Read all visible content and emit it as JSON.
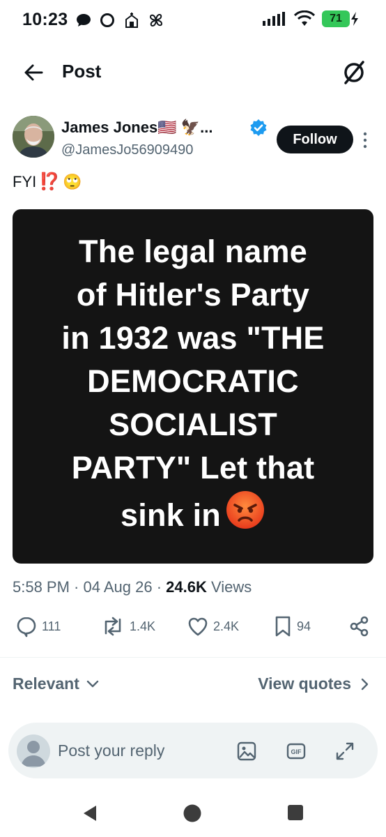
{
  "status_bar": {
    "time": "10:23",
    "battery": "71",
    "notification_icons": [
      "chat-bubble-icon",
      "circle-icon",
      "church-app-icon",
      "pinwheel-icon"
    ]
  },
  "header": {
    "title": "Post"
  },
  "post": {
    "author_name": "James Jones🇺🇸 🦅...",
    "author_handle": "@JamesJo56909490",
    "follow_label": "Follow",
    "text": "FYI",
    "text_emojis": [
      "⁉️",
      "🙄"
    ],
    "image_text_lines": [
      "The legal name",
      "of Hitler's Party",
      "in 1932 was \"THE",
      "DEMOCRATIC",
      "SOCIALIST",
      "PARTY\" Let that",
      "sink in"
    ],
    "time": "5:58 PM",
    "date": "04 Aug 26",
    "views_count": "24.6K",
    "views_label": "Views"
  },
  "actions": {
    "replies": "111",
    "reposts": "1.4K",
    "likes": "2.4K",
    "bookmarks": "94"
  },
  "replies_section": {
    "sort_label": "Relevant",
    "view_quotes_label": "View quotes"
  },
  "reply_box": {
    "placeholder": "Post your reply"
  },
  "colors": {
    "accent_blue": "#1d9bf0",
    "text_primary": "#0f1419",
    "text_secondary": "#536471",
    "battery_green": "#34c759"
  }
}
